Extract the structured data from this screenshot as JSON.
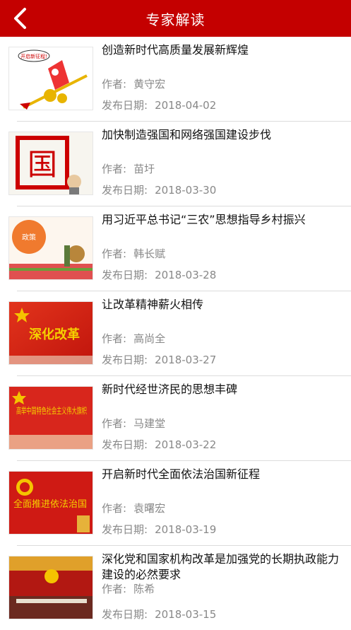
{
  "header": {
    "title": "专家解读"
  },
  "labels": {
    "author": "作者:",
    "date": "发布日期:"
  },
  "articles": [
    {
      "title": "创造新时代高质量发展新辉煌",
      "author": "黄守宏",
      "date": "2018-04-02",
      "thumb_text": "开启新征程!"
    },
    {
      "title": "加快制造强国和网络强国建设步伐",
      "author": "苗圩",
      "date": "2018-03-30",
      "thumb_text": "国"
    },
    {
      "title": "用习近平总书记“三农”思想指导乡村振兴",
      "author": "韩长赋",
      "date": "2018-03-28",
      "thumb_text": "政策"
    },
    {
      "title": "让改革精神薪火相传",
      "author": "高尚全",
      "date": "2018-03-27",
      "thumb_text": "深化改革"
    },
    {
      "title": "新时代经世济民的思想丰碑",
      "author": "马建堂",
      "date": "2018-03-22",
      "thumb_text": "高举中国特色社会主义伟大旗帜"
    },
    {
      "title": "开启新时代全面依法治国新征程",
      "author": "袁曙宏",
      "date": "2018-03-19",
      "thumb_text": "全面推进依法治国"
    },
    {
      "title": "深化党和国家机构改革是加强党的长期执政能力建设的必然要求",
      "author": "陈希",
      "date": "2018-03-15",
      "thumb_text": ""
    }
  ],
  "colors": {
    "accent": "#c40000"
  }
}
